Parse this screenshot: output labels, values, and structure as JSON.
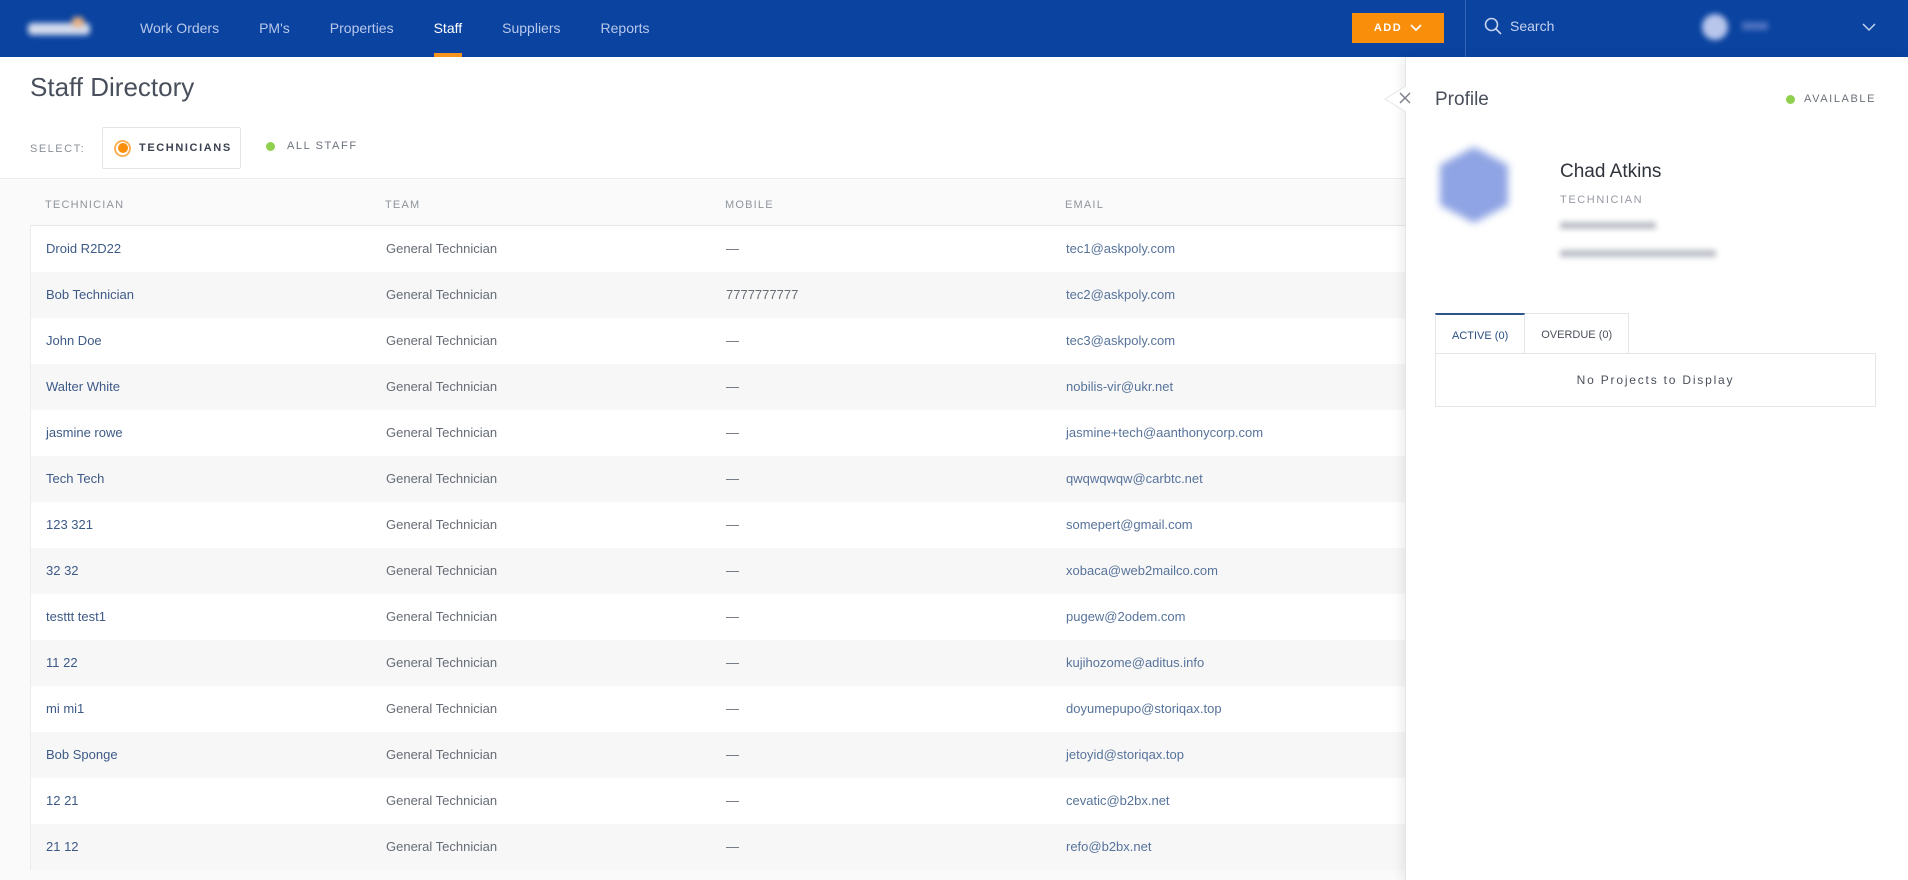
{
  "topbar": {
    "logo": "app-logo",
    "nav": [
      {
        "label": "Work Orders",
        "active": false
      },
      {
        "label": "PM's",
        "active": false
      },
      {
        "label": "Properties",
        "active": false
      },
      {
        "label": "Staff",
        "active": true
      },
      {
        "label": "Suppliers",
        "active": false
      },
      {
        "label": "Reports",
        "active": false
      }
    ],
    "add_label": "ADD",
    "search_placeholder": "Search",
    "accent_color": "#f88e0a",
    "bar_color": "#0a43a0"
  },
  "page": {
    "title": "Staff Directory",
    "select_label": "SELECT:",
    "filters": [
      {
        "label": "TECHNICIANS",
        "selected": true
      },
      {
        "label": "ALL STAFF",
        "selected": false
      }
    ]
  },
  "table": {
    "columns": [
      "TECHNICIAN",
      "TEAM",
      "MOBILE",
      "EMAIL"
    ],
    "rows": [
      {
        "name": "Droid R2D22",
        "team": "General Technician",
        "mobile": "—",
        "email": "tec1@askpoly.com"
      },
      {
        "name": "Bob Technician",
        "team": "General Technician",
        "mobile": "7777777777",
        "email": "tec2@askpoly.com"
      },
      {
        "name": "John Doe",
        "team": "General Technician",
        "mobile": "—",
        "email": "tec3@askpoly.com"
      },
      {
        "name": "Walter White",
        "team": "General Technician",
        "mobile": "—",
        "email": "nobilis-vir@ukr.net"
      },
      {
        "name": "jasmine rowe",
        "team": "General Technician",
        "mobile": "—",
        "email": "jasmine+tech@aanthonycorp.com"
      },
      {
        "name": "Tech Tech",
        "team": "General Technician",
        "mobile": "—",
        "email": "qwqwqwqw@carbtc.net"
      },
      {
        "name": "123 321",
        "team": "General Technician",
        "mobile": "—",
        "email": "somepert@gmail.com"
      },
      {
        "name": "32 32",
        "team": "General Technician",
        "mobile": "—",
        "email": "xobaca@web2mailco.com"
      },
      {
        "name": "testtt test1",
        "team": "General Technician",
        "mobile": "—",
        "email": "pugew@2odem.com"
      },
      {
        "name": "11 22",
        "team": "General Technician",
        "mobile": "—",
        "email": "kujihozome@aditus.info"
      },
      {
        "name": "mi mi1",
        "team": "General Technician",
        "mobile": "—",
        "email": "doyumepupo@storiqax.top"
      },
      {
        "name": "Bob Sponge",
        "team": "General Technician",
        "mobile": "—",
        "email": "jetoyid@storiqax.top"
      },
      {
        "name": "12 21",
        "team": "General Technician",
        "mobile": "—",
        "email": "cevatic@b2bx.net"
      },
      {
        "name": "21 12",
        "team": "General Technician",
        "mobile": "—",
        "email": "refo@b2bx.net"
      }
    ]
  },
  "profile": {
    "title": "Profile",
    "status": "AVAILABLE",
    "status_color": "#8fd14f",
    "name": "Chad Atkins",
    "role": "TECHNICIAN",
    "tabs": [
      {
        "label": "ACTIVE (0)",
        "active": true
      },
      {
        "label": "OVERDUE (0)",
        "active": false
      }
    ],
    "empty_message": "No Projects to Display"
  }
}
